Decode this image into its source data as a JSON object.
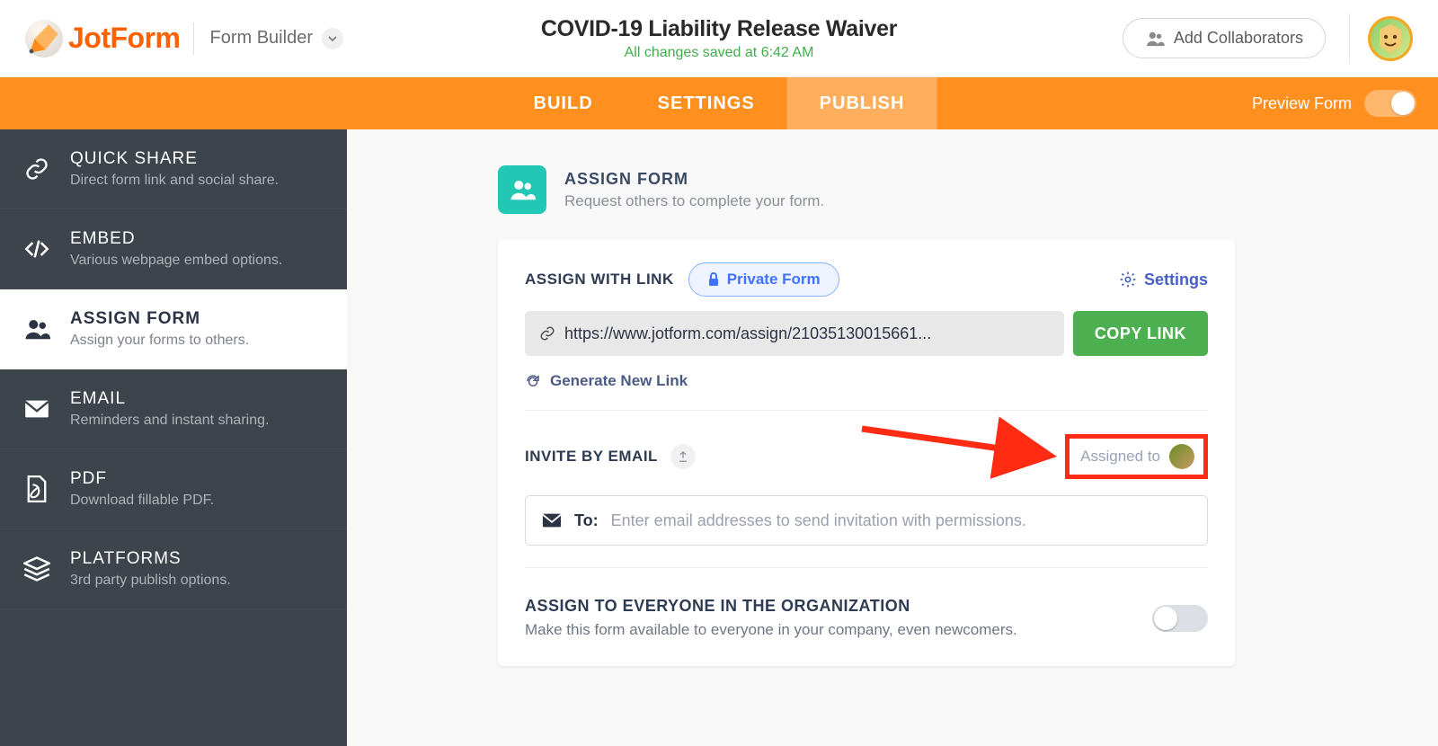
{
  "header": {
    "brand": "JotForm",
    "mode": "Form Builder",
    "title": "COVID-19 Liability Release Waiver",
    "saved": "All changes saved at 6:42 AM",
    "collab": "Add Collaborators"
  },
  "nav": {
    "tabs": [
      "BUILD",
      "SETTINGS",
      "PUBLISH"
    ],
    "active": 2,
    "preview": "Preview Form"
  },
  "sidebar": [
    {
      "title": "QUICK SHARE",
      "desc": "Direct form link and social share."
    },
    {
      "title": "EMBED",
      "desc": "Various webpage embed options."
    },
    {
      "title": "ASSIGN FORM",
      "desc": "Assign your forms to others."
    },
    {
      "title": "EMAIL",
      "desc": "Reminders and instant sharing."
    },
    {
      "title": "PDF",
      "desc": "Download fillable PDF."
    },
    {
      "title": "PLATFORMS",
      "desc": "3rd party publish options."
    }
  ],
  "sidebar_active": 2,
  "page": {
    "head_title": "ASSIGN FORM",
    "head_sub": "Request others to complete your form.",
    "assign_link_title": "ASSIGN WITH LINK",
    "private_label": "Private Form",
    "settings_label": "Settings",
    "url": "https://www.jotform.com/assign/21035130015661...",
    "copy": "COPY LINK",
    "generate": "Generate New Link",
    "invite_title": "INVITE BY EMAIL",
    "assigned_to": "Assigned to",
    "to_label": "To:",
    "email_placeholder": "Enter email addresses to send invitation with permissions.",
    "org_title": "ASSIGN TO EVERYONE IN THE ORGANIZATION",
    "org_desc": "Make this form available to everyone in your company, even newcomers."
  }
}
